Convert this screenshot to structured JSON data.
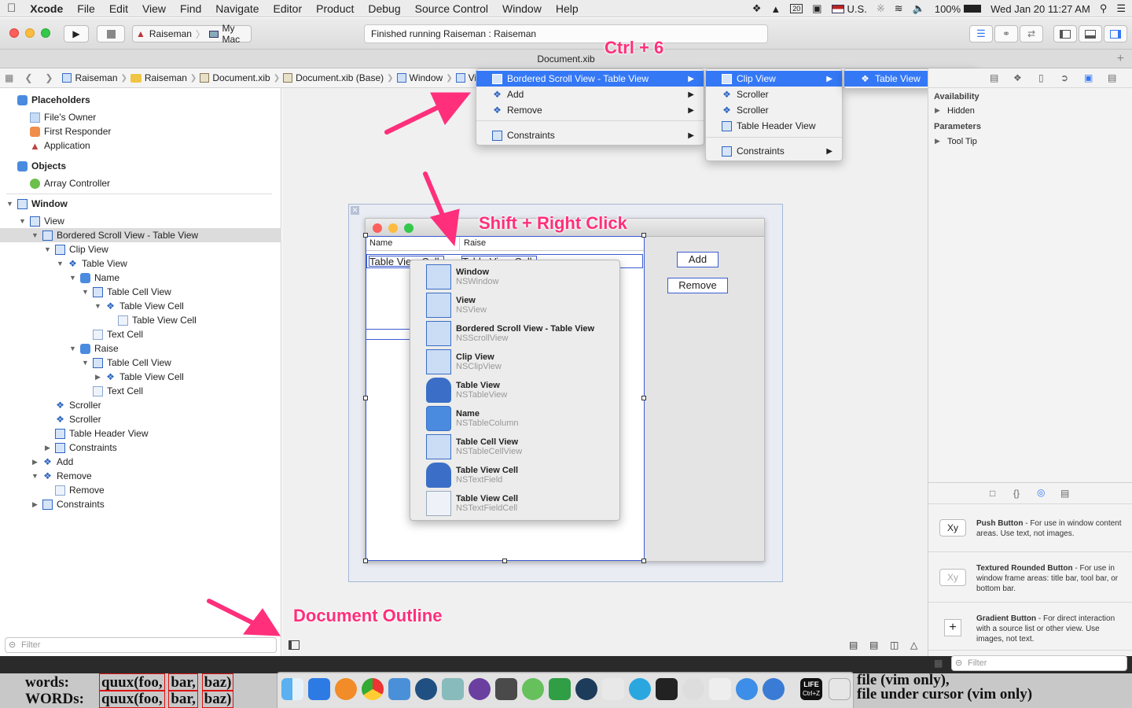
{
  "menubar": {
    "items": [
      "Xcode",
      "File",
      "Edit",
      "View",
      "Find",
      "Navigate",
      "Editor",
      "Product",
      "Debug",
      "Source Control",
      "Window",
      "Help"
    ],
    "status": {
      "calendar_day": "20",
      "input_source": "U.S.",
      "battery": "100%",
      "clock": "Wed Jan 20  11:27 AM"
    }
  },
  "toolbar": {
    "scheme": "Raiseman",
    "destination": "My Mac",
    "activity": "Finished running Raiseman : Raiseman"
  },
  "tab": {
    "title": "Document.xib"
  },
  "jumpbar": {
    "items": [
      "Raiseman",
      "Raiseman",
      "Document.xib",
      "Document.xib (Base)",
      "Window",
      "Vie"
    ]
  },
  "outline": {
    "placeholders": "Placeholders",
    "files_owner": "File's Owner",
    "first_responder": "First Responder",
    "application": "Application",
    "objects": "Objects",
    "array_controller": "Array Controller",
    "tree": [
      "Window",
      "View",
      "Bordered Scroll View - Table View",
      "Clip View",
      "Table View",
      "Name",
      "Table Cell View",
      "Table View Cell",
      "Table View Cell",
      "Text Cell",
      "Raise",
      "Table View Cell",
      "Table View Cell",
      "Text Cell",
      "Scroller",
      "Scroller",
      "Table Header View",
      "Constraints",
      "Add",
      "Remove",
      "Remove",
      "Constraints"
    ],
    "tree_b": [
      "Table Cell View"
    ],
    "filter_placeholder": "Filter"
  },
  "mockwindow": {
    "col1": "Name",
    "col2": "Raise",
    "cell1": "Table View Cell",
    "cell2": "Table View Cell",
    "add": "Add",
    "remove": "Remove"
  },
  "popup": [
    {
      "title": "Window",
      "cls": "NSWindow"
    },
    {
      "title": "View",
      "cls": "NSView"
    },
    {
      "title": "Bordered Scroll View - Table View",
      "cls": "NSScrollView"
    },
    {
      "title": "Clip View",
      "cls": "NSClipView"
    },
    {
      "title": "Table View",
      "cls": "NSTableView"
    },
    {
      "title": "Name",
      "cls": "NSTableColumn"
    },
    {
      "title": "Table Cell View",
      "cls": "NSTableCellView"
    },
    {
      "title": "Table View Cell",
      "cls": "NSTextField"
    },
    {
      "title": "Table View Cell",
      "cls": "NSTextFieldCell"
    }
  ],
  "menu1": {
    "items": [
      "Bordered Scroll View - Table View",
      "Add",
      "Remove",
      "Constraints"
    ]
  },
  "menu2": {
    "items": [
      "Clip View",
      "Scroller",
      "Scroller",
      "Table Header View",
      "Constraints"
    ]
  },
  "menu3": {
    "items": [
      "Table View"
    ]
  },
  "inspector": {
    "availability": "Availability",
    "hidden": "Hidden",
    "parameters": "Parameters",
    "tooltip": "Tool Tip",
    "library": [
      {
        "thumb": "Xy",
        "name": "Push Button",
        "desc": " - For use in window content areas. Use text, not images."
      },
      {
        "thumb": "Xy",
        "name": "Textured Rounded Button",
        "desc": " - For use in window frame areas: title bar, tool bar, or bottom bar."
      },
      {
        "thumb": "+",
        "name": "Gradient Button",
        "desc": " - For direct interaction with a source list or other view. Use images, not text."
      }
    ],
    "filter_placeholder": "Filter"
  },
  "annotations": {
    "ctrl6": "Ctrl + 6",
    "shift_right": "Shift + Right Click",
    "doc_outline": "Document Outline"
  },
  "background_terminal": {
    "left_line1_label": "words:",
    "left_line2_label": "WORDs:",
    "line1_tokens": [
      "quux(foo,",
      "bar,",
      "baz)"
    ],
    "line2_tokens": [
      "quux(foo,",
      "bar,",
      "baz)"
    ],
    "right_line1": "file (vim only),",
    "right_line2": "file under cursor (vim only)"
  },
  "dock": {
    "life_label": "LIFE",
    "life_sub": "Ctrl+Z"
  },
  "colors": {
    "accent": "#3478f6",
    "annotation": "#ff2f7b",
    "selection_border": "#3c5bd1"
  }
}
